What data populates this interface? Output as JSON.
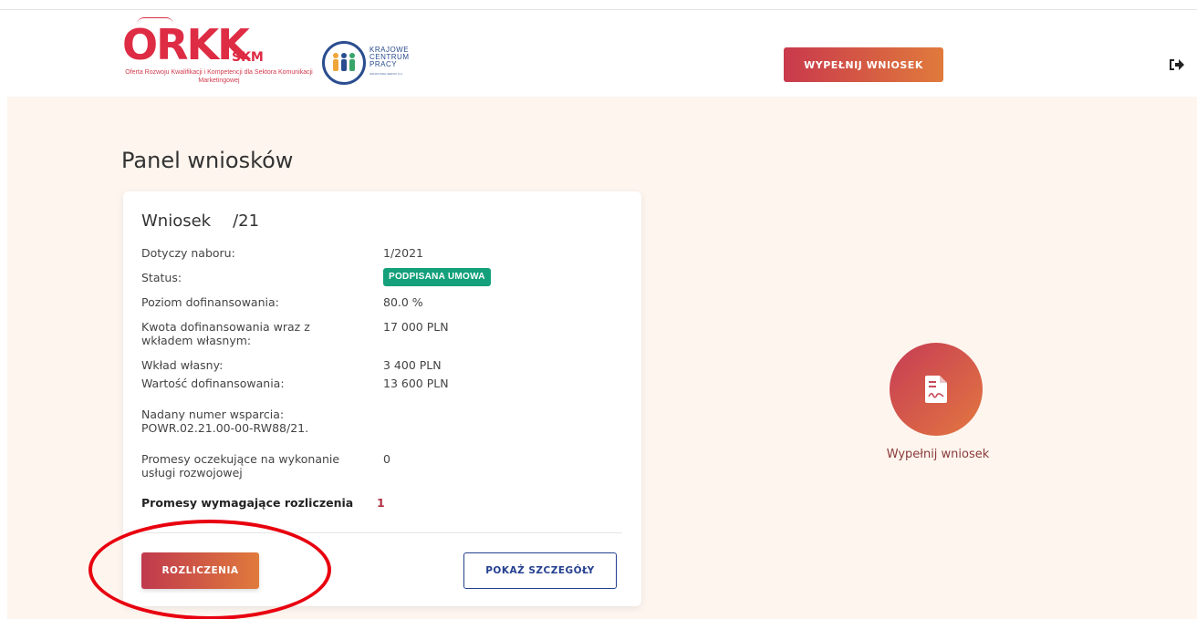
{
  "header": {
    "logo_orkk": {
      "main": "ORKK",
      "skm": "SKM",
      "tagline": "Oferta Rozwoju Kwalifikacji i Kompetencji dla Sektora Komunikacji Marketingowej"
    },
    "logo_kcp": {
      "line1": "KRAJOWE",
      "line2": "CENTRUM",
      "line3": "PRACY",
      "line4": "GRUPA WDH SERVIC S.A."
    },
    "fill_button_label": "WYPEŁNIJ WNIOSEK",
    "logout_icon": "sign-out-icon"
  },
  "main": {
    "page_title": "Panel wniosków",
    "card": {
      "title_prefix": "Wniosek",
      "title_number": "/21",
      "rows": [
        {
          "label": "Dotyczy naboru:",
          "value": "1/2021"
        },
        {
          "label": "Status:",
          "value": "PODPISANA UMOWA"
        },
        {
          "label": "Poziom dofinansowania:",
          "value": "80.0 %"
        },
        {
          "label": "Kwota dofinansowania wraz z",
          "label2": "wkładem własnym:",
          "value": "17 000 PLN"
        },
        {
          "label": "Wkład własny:",
          "value": "3 400 PLN"
        },
        {
          "label": "Wartość dofinansowania:",
          "value": "13 600 PLN"
        },
        {
          "label": "Nadany numer wsparcia:",
          "label2": "POWR.02.21.00-00-RW88/21."
        },
        {
          "label": "Promesy oczekujące na wykonanie",
          "label2": "usługi rozwojowej",
          "value": "0"
        },
        {
          "label": "Promesy wymagające rozliczenia",
          "value": "1"
        }
      ],
      "status_color": "#13a07a",
      "settle_button_label": "ROZLICZENIA",
      "details_button_label": "POKAŻ SZCZEGÓŁY"
    },
    "fill_tile": {
      "icon": "signed-document-icon",
      "label": "Wypełnij wniosek"
    }
  },
  "colors": {
    "accent_start": "#c9394c",
    "accent_end": "#e07a3c",
    "navy": "#25408f",
    "background": "#fdf5ee",
    "annotation": "#e8000f"
  }
}
